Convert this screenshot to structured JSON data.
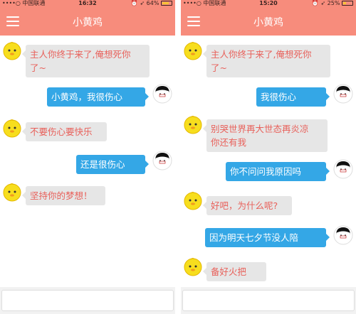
{
  "colors": {
    "header": "#f78c7c",
    "user_bubble": "#34a7e6",
    "bot_bubble": "#e6e6e6",
    "bot_text": "#e8605a"
  },
  "left": {
    "status": {
      "carrier": "••••○ 中国联通",
      "time": "16:32",
      "battery": "64%",
      "battery_level": 0.64
    },
    "title": "小黄鸡",
    "messages": [
      {
        "from": "bot",
        "text": "主人你终于来了,俺想死你\n了~"
      },
      {
        "from": "user",
        "text": "小黄鸡，我很伤心"
      },
      {
        "from": "bot",
        "text": "不要伤心要快乐"
      },
      {
        "from": "user",
        "text": "还是很伤心"
      },
      {
        "from": "bot",
        "text": "坚持你的梦想！"
      }
    ],
    "input": {
      "value": "",
      "placeholder": ""
    }
  },
  "right": {
    "status": {
      "carrier": "••••○ 中国联通",
      "time": "15:20",
      "battery": "25%",
      "battery_level": 0.25
    },
    "title": "小黄鸡",
    "messages": [
      {
        "from": "bot",
        "text": "主人你终于来了,俺想死你\n了~"
      },
      {
        "from": "user",
        "text": "我很伤心"
      },
      {
        "from": "bot",
        "text": "别哭世界再大世态再炎凉\n你还有我"
      },
      {
        "from": "user",
        "text": "你不问问我原因吗"
      },
      {
        "from": "bot",
        "text": "好吧，为什么呢?"
      },
      {
        "from": "user",
        "text": "因为明天七夕节没人陪"
      },
      {
        "from": "bot",
        "text": "备好火把"
      }
    ],
    "input": {
      "value": "",
      "placeholder": ""
    }
  }
}
